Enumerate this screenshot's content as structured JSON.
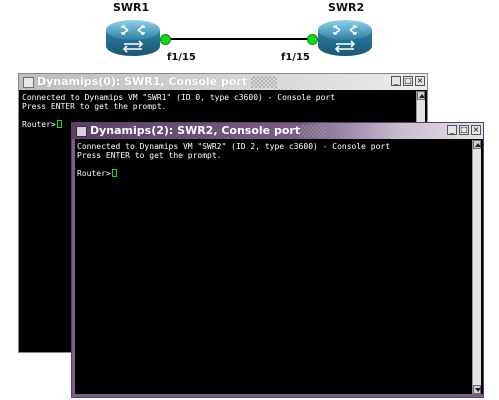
{
  "topology": {
    "nodes": [
      {
        "label": "SWR1"
      },
      {
        "label": "SWR2"
      }
    ],
    "ports": [
      {
        "label": "f1/15"
      },
      {
        "label": "f1/15"
      }
    ],
    "colors": {
      "router_body": "#3b8fb0",
      "link": "#000000",
      "port_up": "#19d819"
    }
  },
  "windows": [
    {
      "title": "Dynamips(0): SWR1, Console port",
      "state": "inactive",
      "lines": [
        "Connected to Dynamips VM \"SWR1\" (ID 0, type c3600) - Console port",
        "Press ENTER to get the prompt."
      ],
      "prompt": "Router>"
    },
    {
      "title": "Dynamips(2): SWR2, Console port",
      "state": "active",
      "lines": [
        "Connected to Dynamips VM \"SWR2\" (ID 2, type c3600) - Console port",
        "Press ENTER to get the prompt."
      ],
      "prompt": "Router>"
    }
  ],
  "window_buttons": {
    "minimize": "_",
    "maximize": "□",
    "close": "×"
  },
  "icons": {
    "router": "router-switch-icon",
    "window": "window-menu-icon"
  },
  "colors": {
    "terminal_bg": "#000000",
    "terminal_text": "#ffffff",
    "cursor": "#19d819",
    "active_title": "#5a3f66"
  }
}
